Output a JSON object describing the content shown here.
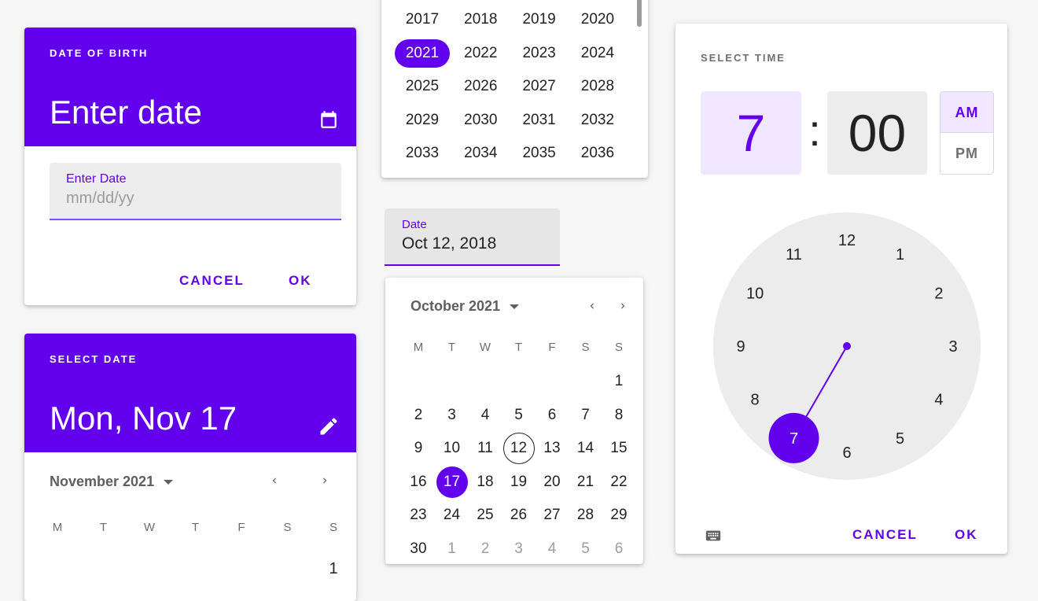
{
  "colors": {
    "primary": "#6200ee",
    "primary_light": "#f1e6ff",
    "surface": "#ffffff",
    "field_bg": "#ececec"
  },
  "dob_card": {
    "overline": "DATE OF BIRTH",
    "headline": "Enter date",
    "mode_icon": "calendar-icon",
    "field_label": "Enter Date",
    "field_placeholder": "mm/dd/yy",
    "field_value": "",
    "cancel_label": "CANCEL",
    "ok_label": "OK"
  },
  "select_date_card": {
    "overline": "SELECT DATE",
    "headline": "Mon, Nov 17",
    "mode_icon": "edit-icon",
    "month_label": "November 2021",
    "weekdays": [
      "M",
      "T",
      "W",
      "T",
      "F",
      "S",
      "S"
    ],
    "first_day": "1"
  },
  "year_picker": {
    "years": [
      "2017",
      "2018",
      "2019",
      "2020",
      "2021",
      "2022",
      "2023",
      "2024",
      "2025",
      "2026",
      "2027",
      "2028",
      "2029",
      "2030",
      "2031",
      "2032",
      "2033",
      "2034",
      "2035",
      "2036"
    ],
    "selected": "2021"
  },
  "date_field": {
    "label": "Date",
    "value": "Oct 12, 2018"
  },
  "october_calendar": {
    "month_label": "October 2021",
    "weekdays": [
      "M",
      "T",
      "W",
      "T",
      "F",
      "S",
      "S"
    ],
    "weeks": [
      [
        "",
        "",
        "",
        "",
        "",
        "",
        "1"
      ],
      [
        "2",
        "3",
        "4",
        "5",
        "6",
        "7",
        "8"
      ],
      [
        "9",
        "10",
        "11",
        "12",
        "13",
        "14",
        "15"
      ],
      [
        "16",
        "17",
        "18",
        "19",
        "20",
        "21",
        "22"
      ],
      [
        "23",
        "24",
        "25",
        "26",
        "27",
        "28",
        "29"
      ],
      [
        "30",
        "1",
        "2",
        "3",
        "4",
        "5",
        "6"
      ]
    ],
    "outside_month_start_index": 1,
    "today": "12",
    "selected": "17"
  },
  "time_picker": {
    "overline": "SELECT TIME",
    "hour": "7",
    "separator": ":",
    "minute": "00",
    "am_label": "AM",
    "pm_label": "PM",
    "period_selected": "AM",
    "dial_numbers": [
      "12",
      "1",
      "2",
      "3",
      "4",
      "5",
      "6",
      "7",
      "8",
      "9",
      "10",
      "11"
    ],
    "selected_hour": 7,
    "keyboard_icon": "keyboard-icon",
    "cancel_label": "CANCEL",
    "ok_label": "OK"
  }
}
